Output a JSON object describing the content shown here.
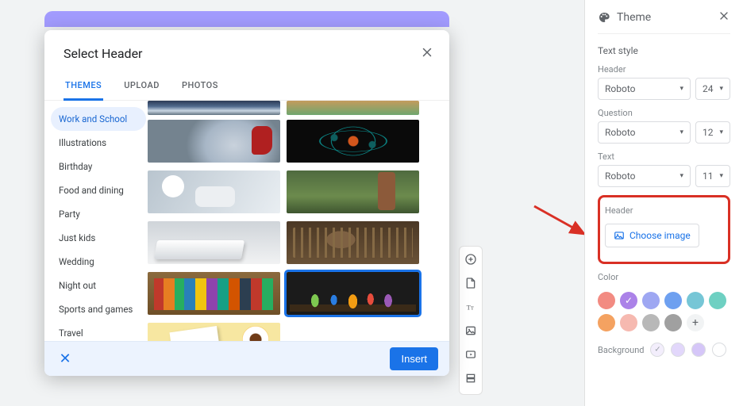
{
  "theme_panel": {
    "title": "Theme",
    "text_style_title": "Text style",
    "font_sections": [
      {
        "label": "Header",
        "font": "Roboto",
        "size": "24"
      },
      {
        "label": "Question",
        "font": "Roboto",
        "size": "12"
      },
      {
        "label": "Text",
        "font": "Roboto",
        "size": "11"
      }
    ],
    "header_section": {
      "label": "Header",
      "choose_image": "Choose image"
    },
    "color_section": {
      "label": "Color",
      "swatches": [
        {
          "hex": "#f28b82",
          "selected": false
        },
        {
          "hex": "#ab82e8",
          "selected": true
        },
        {
          "hex": "#9ea7f2",
          "selected": false
        },
        {
          "hex": "#6ea0f0",
          "selected": false
        },
        {
          "hex": "#76c6d6",
          "selected": false
        },
        {
          "hex": "#6ed0c2",
          "selected": false
        },
        {
          "hex": "#f4a261",
          "selected": false
        },
        {
          "hex": "#f6b9b0",
          "selected": false
        },
        {
          "hex": "#b8b8b8",
          "selected": false
        },
        {
          "hex": "#a0a0a0",
          "selected": false
        }
      ],
      "add_icon": "+"
    },
    "background_section": {
      "label": "Background",
      "swatches": [
        {
          "hex": "#f3eefc",
          "selected": true
        },
        {
          "hex": "#e2d7fb",
          "selected": false
        },
        {
          "hex": "#d5c6f8",
          "selected": false
        },
        {
          "hex": "#ffffff",
          "selected": false
        }
      ]
    }
  },
  "dialog": {
    "title": "Select Header",
    "tabs": [
      {
        "label": "THEMES",
        "active": true
      },
      {
        "label": "UPLOAD",
        "active": false
      },
      {
        "label": "PHOTOS",
        "active": false
      }
    ],
    "categories": [
      {
        "label": "Work and School",
        "active": true
      },
      {
        "label": "Illustrations"
      },
      {
        "label": "Birthday"
      },
      {
        "label": "Food and dining"
      },
      {
        "label": "Party"
      },
      {
        "label": "Just kids"
      },
      {
        "label": "Wedding"
      },
      {
        "label": "Night out"
      },
      {
        "label": "Sports and games"
      },
      {
        "label": "Travel"
      }
    ],
    "selected_thumb_index": 9,
    "insert_label": "Insert",
    "cancel_glyph": "✕"
  },
  "toolbar_icons": [
    "add",
    "import",
    "title",
    "image",
    "video",
    "section"
  ]
}
